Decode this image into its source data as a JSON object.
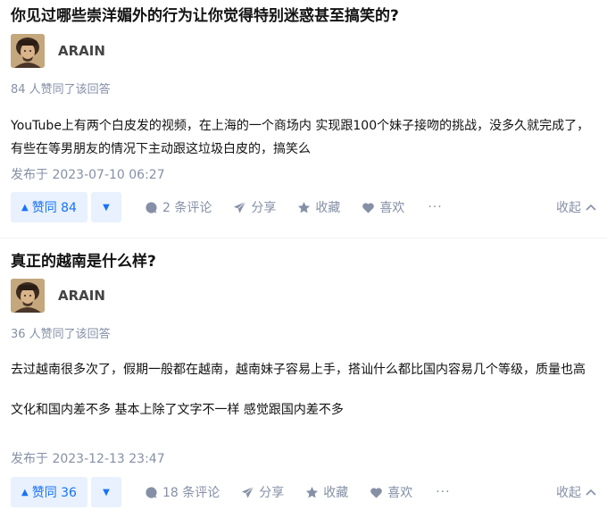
{
  "answers": [
    {
      "question_title": "你见过哪些崇洋媚外的行为让你觉得特别迷惑甚至搞笑的?",
      "author_name": "ARAIN",
      "voters_text": "84 人赞同了该回答",
      "content": [
        "YouTube上有两个白皮发的视频，在上海的一个商场内 实现跟100个妹子接吻的挑战，没多久就完成了，有些在等男朋友的情况下主动跟这垃圾白皮的，搞笑么"
      ],
      "published": "发布于 2023-07-10 06:27",
      "vote_label": "赞同 84",
      "comments_label": "2 条评论",
      "share_label": "分享",
      "favorite_label": "收藏",
      "like_label": "喜欢",
      "more_label": "···",
      "collapse_label": "收起"
    },
    {
      "question_title": "真正的越南是什么样?",
      "author_name": "ARAIN",
      "voters_text": "36 人赞同了该回答",
      "content": [
        "去过越南很多次了，假期一般都在越南，越南妹子容易上手，搭讪什么都比国内容易几个等级，质量也高",
        "文化和国内差不多 基本上除了文字不一样 感觉跟国内差不多"
      ],
      "published": "发布于 2023-12-13 23:47",
      "vote_label": "赞同 36",
      "comments_label": "18 条评论",
      "share_label": "分享",
      "favorite_label": "收藏",
      "like_label": "喜欢",
      "more_label": "···",
      "collapse_label": "收起"
    }
  ],
  "colors": {
    "accent": "#1772f6",
    "vote_bg": "#e8f1fd",
    "muted": "#8590a6",
    "text": "#121212"
  },
  "icons": [
    "thumb-up-icon",
    "caret-down-icon",
    "comment-icon",
    "share-icon",
    "star-icon",
    "heart-icon",
    "more-icon",
    "chevron-up-icon"
  ]
}
